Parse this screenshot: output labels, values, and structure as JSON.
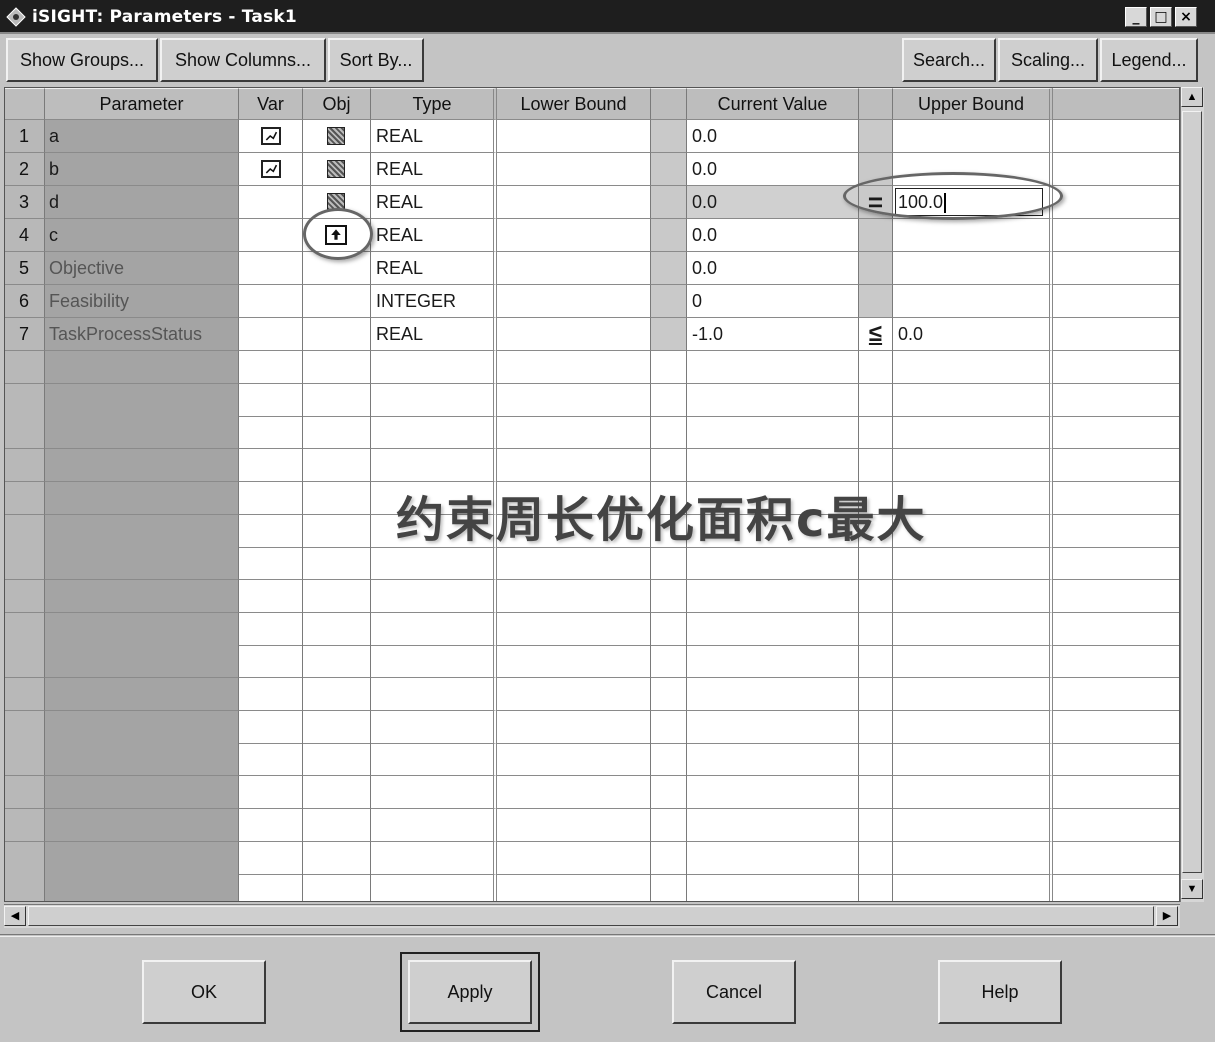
{
  "window": {
    "title": "iSIGHT: Parameters - Task1",
    "icon": "isight-diamond-icon",
    "controls": [
      "minimize",
      "maximize",
      "close"
    ]
  },
  "toolbar": {
    "show_groups": "Show Groups...",
    "show_columns": "Show Columns...",
    "sort_by": "Sort By...",
    "search": "Search...",
    "scaling": "Scaling...",
    "legend": "Legend..."
  },
  "columns": {
    "parameter": "Parameter",
    "var": "Var",
    "obj": "Obj",
    "type": "Type",
    "lower_bound": "Lower Bound",
    "current_value": "Current Value",
    "upper_bound": "Upper Bound"
  },
  "rows": [
    {
      "num": "1",
      "name": "a",
      "var": true,
      "obj": "checkered",
      "type": "REAL",
      "current": "0.0",
      "op": "",
      "upper": ""
    },
    {
      "num": "2",
      "name": "b",
      "var": true,
      "obj": "checkered",
      "type": "REAL",
      "current": "0.0",
      "op": "",
      "upper": ""
    },
    {
      "num": "3",
      "name": "d",
      "var": false,
      "obj": "checkered",
      "type": "REAL",
      "current": "0.0",
      "op": "=",
      "upper": "100.0"
    },
    {
      "num": "4",
      "name": "c",
      "var": false,
      "obj": "maximize-arrow",
      "type": "REAL",
      "current": "0.0",
      "op": "",
      "upper": ""
    },
    {
      "num": "5",
      "name": "Objective",
      "var": false,
      "obj": "",
      "type": "REAL",
      "current": "0.0",
      "op": "",
      "upper": ""
    },
    {
      "num": "6",
      "name": "Feasibility",
      "var": false,
      "obj": "",
      "type": "INTEGER",
      "current": "0",
      "op": "",
      "upper": ""
    },
    {
      "num": "7",
      "name": "TaskProcessStatus",
      "var": false,
      "obj": "",
      "type": "REAL",
      "current": "-1.0",
      "op": "≤",
      "upper": "0.0"
    }
  ],
  "overlay_text": "约束周长优化面积c最大",
  "buttons": {
    "ok": "OK",
    "apply": "Apply",
    "cancel": "Cancel",
    "help": "Help"
  }
}
